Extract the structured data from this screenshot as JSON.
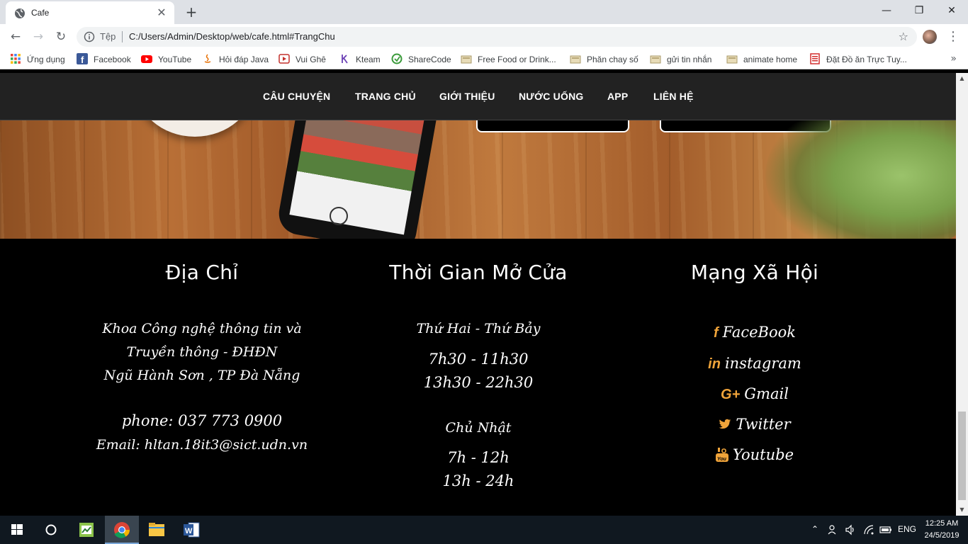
{
  "browser": {
    "tab_title": "Cafe",
    "tab_close": "✕",
    "new_tab": "+",
    "window_controls": {
      "minimize": "—",
      "restore": "❐",
      "close": "✕"
    },
    "nav": {
      "back": "←",
      "forward": "→",
      "reload": "↻"
    },
    "omnibox": {
      "scheme_label": "Tệp",
      "url": "C:/Users/Admin/Desktop/web/cafe.html#TrangChu",
      "star": "☆"
    },
    "menu": "⋮",
    "bookmarks": [
      {
        "label": "Ứng dụng",
        "icon": "apps-grid-icon"
      },
      {
        "label": "Facebook",
        "icon": "facebook-icon"
      },
      {
        "label": "YouTube",
        "icon": "youtube-icon"
      },
      {
        "label": "Hỏi đáp Java",
        "icon": "java-icon"
      },
      {
        "label": "Vui Ghê",
        "icon": "video-icon"
      },
      {
        "label": "Kteam",
        "icon": "kteam-icon"
      },
      {
        "label": "ShareCode",
        "icon": "sharecode-icon"
      },
      {
        "label": "Free Food or Drink...",
        "icon": "folder-icon"
      },
      {
        "label": "Phăn chay số",
        "icon": "folder-icon"
      },
      {
        "label": "gửi tin nhắn",
        "icon": "folder-icon"
      },
      {
        "label": "animate home",
        "icon": "folder-icon"
      },
      {
        "label": "Đặt Đồ ăn Trực Tuy...",
        "icon": "document-icon"
      }
    ],
    "bookmarks_more": "»"
  },
  "site": {
    "nav": [
      "CÂU CHUYỆN",
      "TRANG CHỦ",
      "GIỚI THIỆU",
      "NƯỚC UỐNG",
      "APP",
      "LIÊN HỆ"
    ],
    "address": {
      "heading": "Địa Chỉ",
      "line1": "Khoa Công nghệ thông tin và",
      "line2": "Truyền thông - ĐHĐN",
      "line3": "Ngũ Hành Sơn , TP Đà Nẵng",
      "phone": "phone: 037 773 0900",
      "email": "Email: hltan.18it3@sict.udn.vn"
    },
    "hours": {
      "heading": "Thời Gian Mở Cửa",
      "weekday_label": "Thứ Hai - Thứ Bảy",
      "weekday_morning": "7h30 - 11h30",
      "weekday_afternoon": "13h30 - 22h30",
      "sunday_label": "Chủ Nhật",
      "sunday_morning": "7h - 12h",
      "sunday_afternoon": "13h - 24h"
    },
    "social": {
      "heading": "Mạng Xã Hội",
      "links": [
        {
          "label": "FaceBook",
          "icon": "facebook-icon",
          "glyph": "f"
        },
        {
          "label": "instagram",
          "icon": "linkedin-icon",
          "glyph": "in"
        },
        {
          "label": "Gmail",
          "icon": "google-plus-icon",
          "glyph": "G+"
        },
        {
          "label": "Twitter",
          "icon": "twitter-icon",
          "glyph": "🐦"
        },
        {
          "label": "Youtube",
          "icon": "youtube-icon",
          "glyph": "▣"
        }
      ]
    }
  },
  "taskbar": {
    "apps": [
      "start-icon",
      "cortana-icon",
      "app-icon",
      "chrome-icon",
      "file-explorer-icon",
      "word-icon"
    ],
    "language": "ENG",
    "time": "12:25 AM",
    "date": "24/5/2019"
  },
  "colors": {
    "accent_orange": "#f0a43a",
    "nav_bg": "#222222",
    "footer_bg": "#000000"
  }
}
